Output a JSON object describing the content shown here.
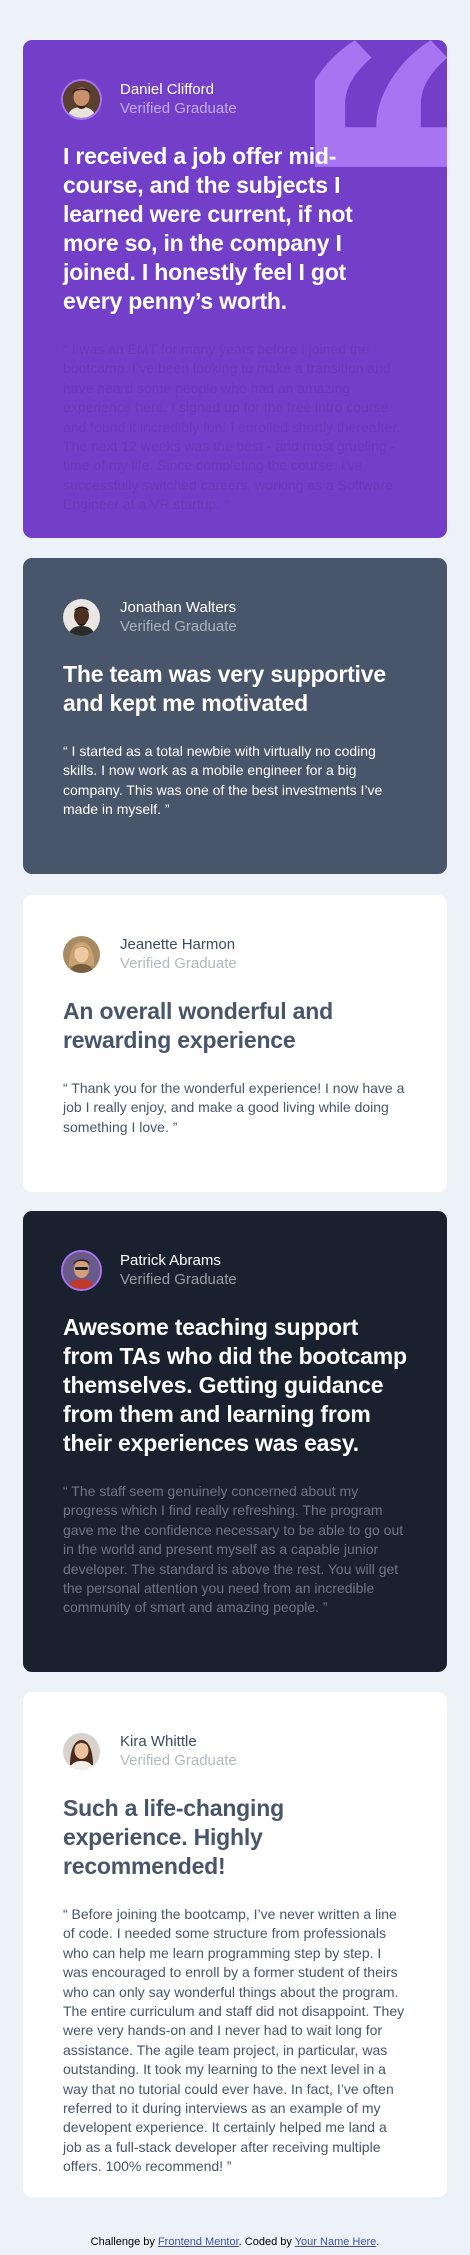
{
  "testimonials": [
    {
      "name": "Daniel Clifford",
      "status": "Verified Graduate",
      "headline": "I received a job offer mid-course, and the subjects I learned were current, if not more so, in the company I joined. I honestly feel I got every penny’s worth.",
      "quote": "“ I was an EMT for many years before I joined the bootcamp. I’ve been looking to make a transition and have heard some people who had an amazing experience here. I signed up for the free intro course and found it incredibly fun! I enrolled shortly thereafter. The next 12 weeks was the best - and most grueling - time of my life. Since completing the course, I’ve successfully switched careers, working as a Software Engineer at a VR startup. ”"
    },
    {
      "name": "Jonathan Walters",
      "status": "Verified Graduate",
      "headline": "The team was very supportive and kept me motivated",
      "quote": "“ I started as a total newbie with virtually no coding skills. I now work as a mobile engineer for a big company. This was one of the best investments I’ve made in myself. ”"
    },
    {
      "name": "Jeanette Harmon",
      "status": "Verified Graduate",
      "headline": "An overall wonderful and rewarding experience",
      "quote": "“ Thank you for the wonderful experience! I now have a job I really enjoy, and make a good living while doing something I love. ”"
    },
    {
      "name": "Patrick Abrams",
      "status": "Verified Graduate",
      "headline": "Awesome teaching support from TAs who did the bootcamp themselves. Getting guidance from them and learning from their experiences was easy.",
      "quote": "“ The staff seem genuinely concerned about my progress which I find really refreshing. The program gave me the confidence necessary to be able to go out in the world and present myself as a capable junior developer. The standard is above the rest. You will get the personal attention you need from an incredible community of smart and amazing people. ”"
    },
    {
      "name": "Kira Whittle",
      "status": "Verified Graduate",
      "headline": "Such a life-changing experience. Highly recommended!",
      "quote": "“ Before joining the bootcamp, I’ve never written a line of code. I needed some structure from professionals who can help me learn programming step by step. I was encouraged to enroll by a former student of theirs who can only say wonderful things about the program. The entire curriculum and staff did not disappoint. They were very hands-on and I never had to wait long for assistance. The agile team project, in particular, was outstanding. It took my learning to the next level in a way that no tutorial could ever have. In fact, I’ve often referred to it during interviews as an example of my developent experience. It certainly helped me land a job as a full-stack developer after receiving multiple offers. 100% recommend! ”"
    }
  ],
  "footer": {
    "prefix": "Challenge by ",
    "challenge_link": "Frontend Mentor",
    "middle": ". Coded by ",
    "author_link": "Your Name Here",
    "suffix": "."
  },
  "colors": {
    "moderate_violet": "#733fc8",
    "very_dark_grayish_blue": "#48556a",
    "very_dark_blackish_blue": "#19212e",
    "white": "#ffffff",
    "background": "#ecf2f8"
  },
  "icons": [
    "quotation-icon"
  ]
}
